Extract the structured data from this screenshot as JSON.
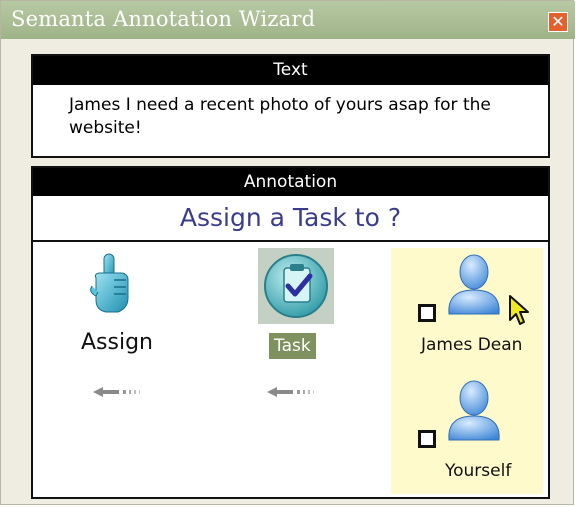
{
  "window": {
    "title": "Semanta Annotation Wizard",
    "close_symbol": "✕"
  },
  "text_panel": {
    "header": "Text",
    "body": "James I need a recent photo of yours asap for the website!"
  },
  "annotation_panel": {
    "header": "Annotation",
    "question": "Assign a Task to ?",
    "steps": [
      {
        "label": "Assign",
        "icon": "pointing-hand-icon"
      },
      {
        "label": "Task",
        "icon": "clipboard-check-icon"
      }
    ],
    "choices": [
      {
        "label": "James Dean",
        "icon": "person-icon",
        "checked": false
      },
      {
        "label": "Yourself",
        "icon": "person-icon",
        "checked": false
      }
    ]
  },
  "colors": {
    "titlebar": "#9fb388",
    "close_button": "#e2612f",
    "question_text": "#3c3c8c",
    "task_highlight": "#7e915e",
    "choices_background": "#fffacc"
  }
}
